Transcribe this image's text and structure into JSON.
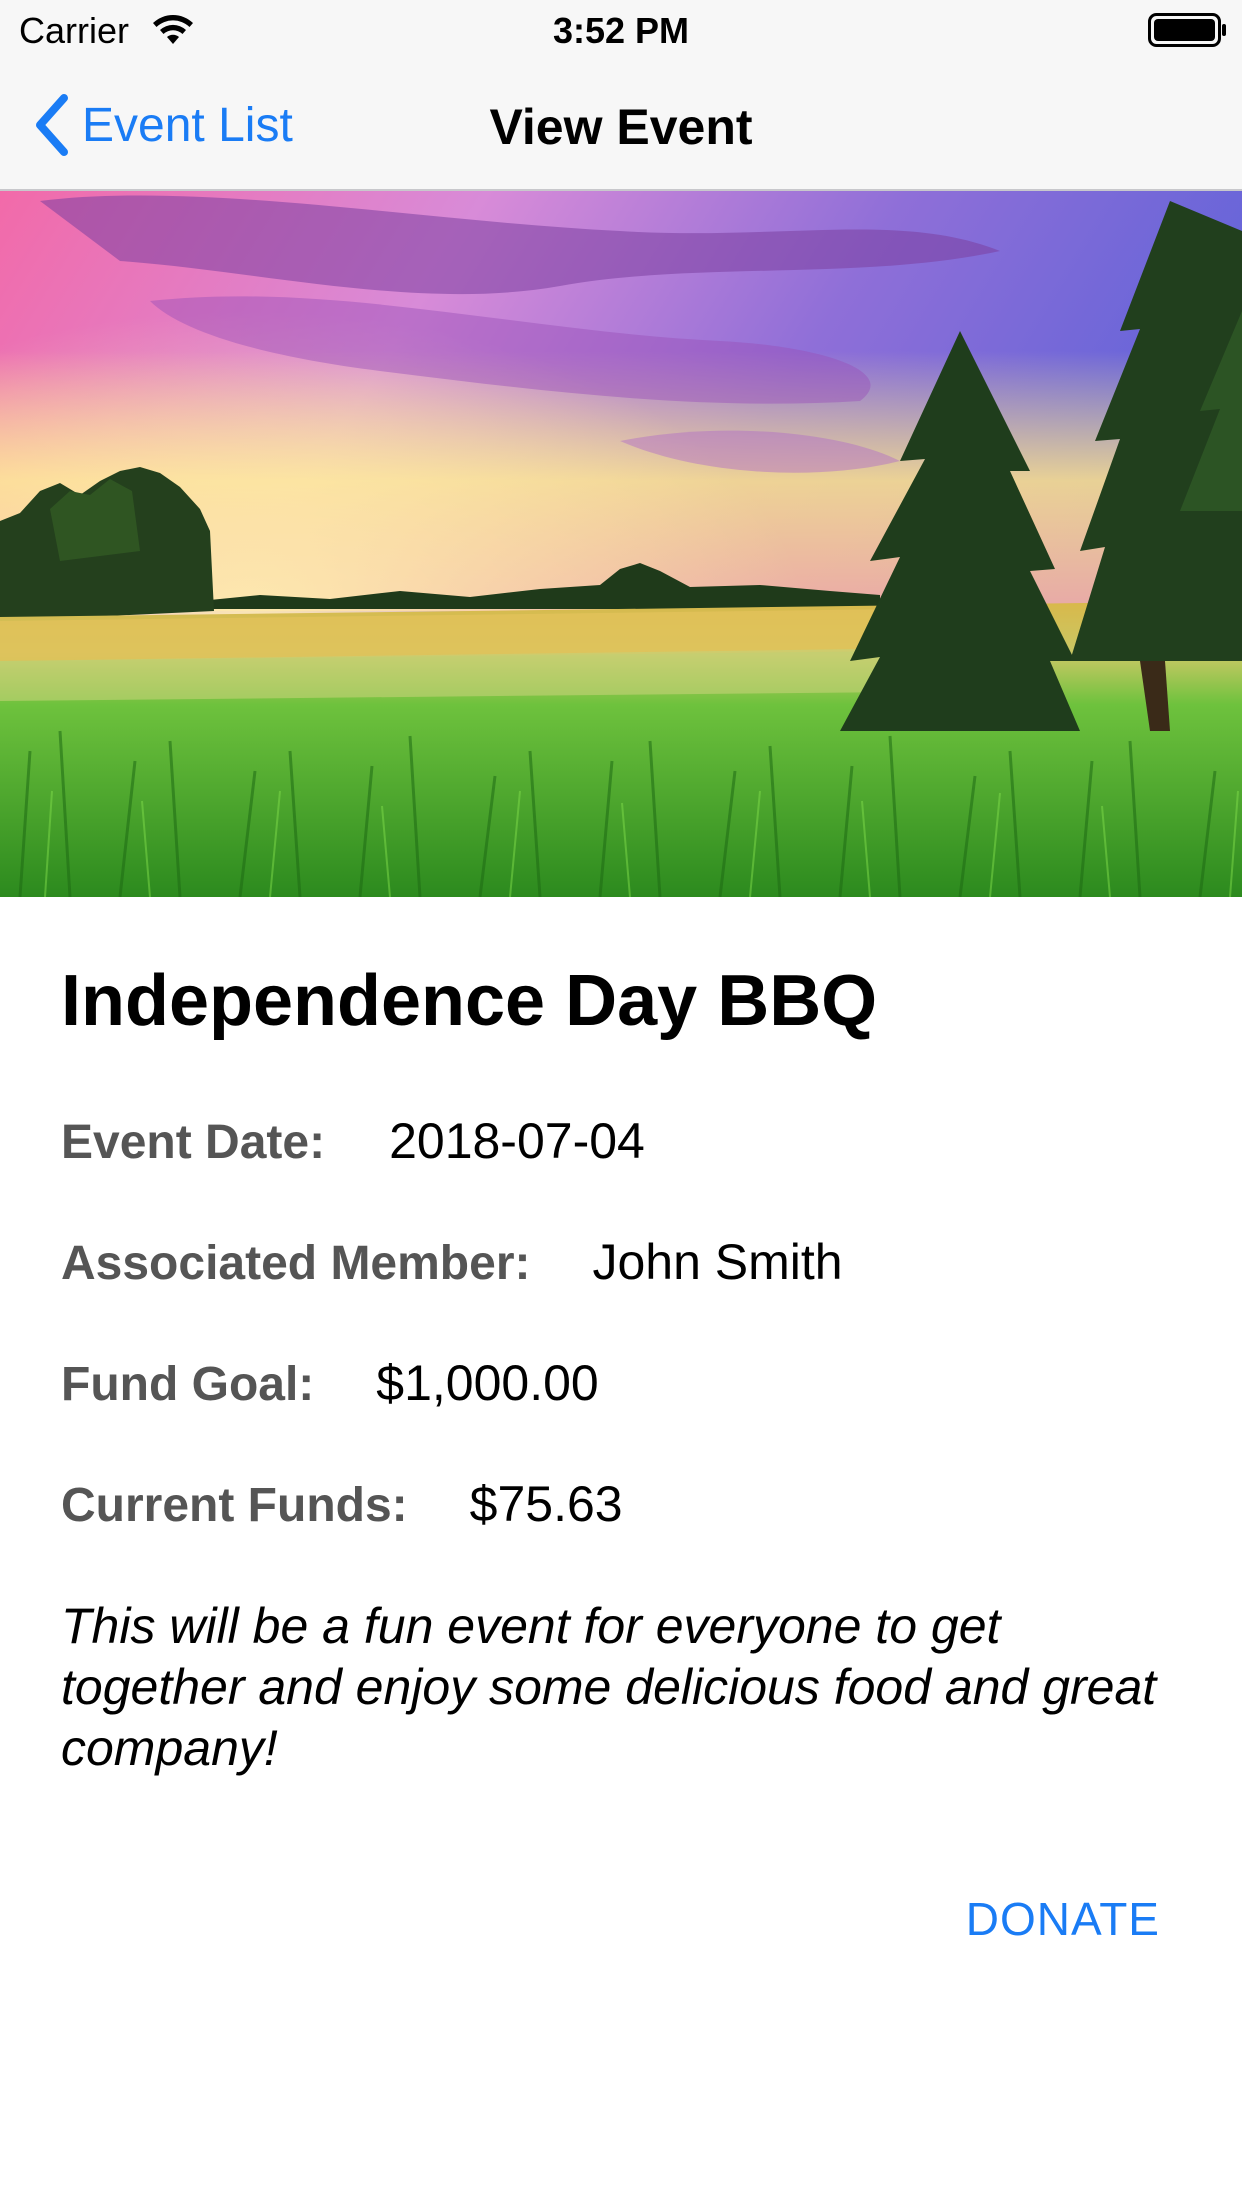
{
  "status_bar": {
    "carrier": "Carrier",
    "time": "3:52 PM"
  },
  "nav_bar": {
    "back_label": "Event List",
    "title": "View Event"
  },
  "event": {
    "title": "Independence Day BBQ",
    "date_label": "Event Date:",
    "date_value": "2018-07-04",
    "member_label": "Associated Member:",
    "member_value": "John Smith",
    "goal_label": "Fund Goal:",
    "goal_value": "$1,000.00",
    "funds_label": "Current Funds:",
    "funds_value": "$75.63",
    "description": "This will be a fun event for everyone to get together and enjoy some delicious food and great company!"
  },
  "actions": {
    "donate_label": "DONATE"
  },
  "colors": {
    "accent": "#1a7cf5",
    "label_gray": "#555555",
    "bar_background": "#f7f7f7"
  },
  "icons": {
    "wifi": "wifi-icon",
    "battery": "battery-icon",
    "back": "chevron-left-icon"
  }
}
